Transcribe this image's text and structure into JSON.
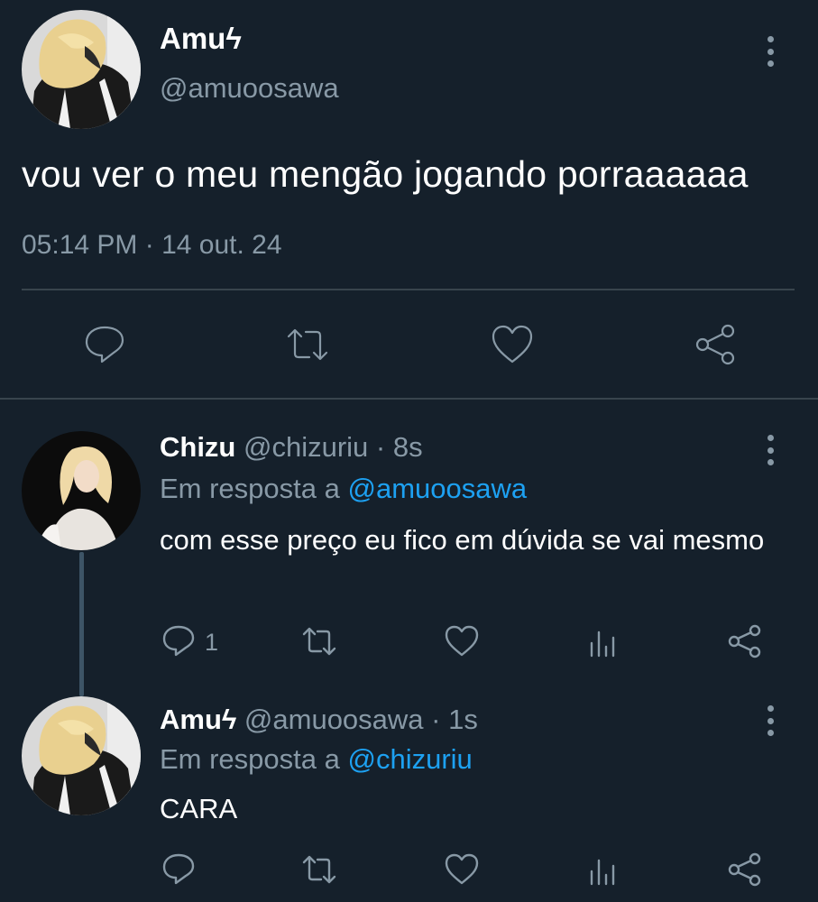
{
  "main_tweet": {
    "name": "Amuϟ",
    "handle": "@amuoosawa",
    "text": "vou ver o meu mengão jogando porraaaaaa",
    "meta": "05:14 PM · 14 out. 24",
    "icons": [
      "reply-icon",
      "retweet-icon",
      "like-icon",
      "share-icon",
      "more-icon"
    ]
  },
  "replies": [
    {
      "name": "Chizu",
      "meta": "@chizuriu · 8s",
      "reply_prefix": "Em resposta a ",
      "reply_mention": "@amuoosawa",
      "text": "com esse preço eu fico em dúvida se vai mesmo",
      "reply_count": "1",
      "icons": [
        "reply-icon",
        "retweet-icon",
        "like-icon",
        "stats-icon",
        "share-icon"
      ]
    },
    {
      "name": "Amuϟ",
      "meta": "@amuoosawa · 1s",
      "reply_prefix": "Em resposta a ",
      "reply_mention": "@chizuriu",
      "text": "CARA",
      "reply_count": "",
      "icons": [
        "reply-icon",
        "retweet-icon",
        "like-icon",
        "stats-icon",
        "share-icon"
      ]
    }
  ],
  "colors": {
    "background": "#15202b",
    "text_primary": "#ffffff",
    "text_secondary": "#8899a6",
    "accent": "#1da1f2",
    "divider": "#38444d"
  }
}
